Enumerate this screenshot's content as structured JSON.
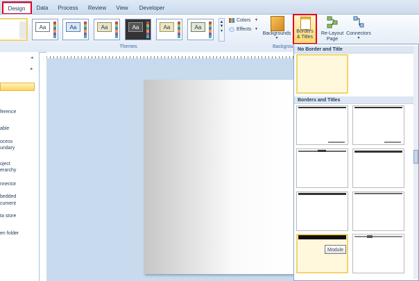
{
  "tabs": [
    {
      "label": "Design",
      "active": true
    },
    {
      "label": "Data",
      "active": false
    },
    {
      "label": "Process",
      "active": false
    },
    {
      "label": "Review",
      "active": false
    },
    {
      "label": "View",
      "active": false
    },
    {
      "label": "Developer",
      "active": false
    }
  ],
  "ribbon": {
    "themes_group": "Themes",
    "theme_tiles": [
      "Aa",
      "Aa",
      "Aa",
      "Aa",
      "Aa",
      "Aa"
    ],
    "colors_label": "Colors",
    "effects_label": "Effects",
    "backgrounds_label": "Backgrounds",
    "borders_line1": "Borders",
    "borders_line2": "& Titles",
    "relayout_line1": "Re-Layout",
    "relayout_line2": "Page",
    "connectors_label": "Connectors",
    "backgrounds_group": "Backgrou"
  },
  "left_pane": {
    "items": [
      "ference",
      "able",
      "ocess",
      "undary",
      "oject",
      "erarchy",
      "nnector",
      "bedded",
      "cument",
      "ta store",
      "en folder"
    ]
  },
  "gallery": {
    "section_no_border": "No Border and Title",
    "section_borders": "Borders and Titles",
    "tooltip": "Module"
  },
  "colors": {
    "accent_red": "#e3001b",
    "selected_gold": "#f4d26b",
    "ribbon_blue": "#dfe9f5",
    "canvas_blue": "#c8daed"
  }
}
